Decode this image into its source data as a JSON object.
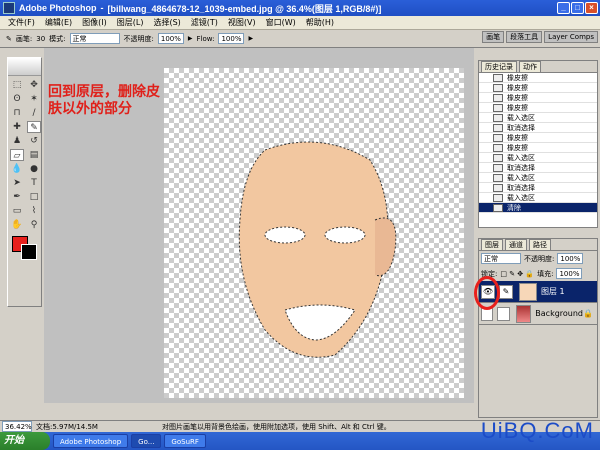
{
  "titlebar": {
    "app": "Adobe Photoshop",
    "file": "[billwang_4864678-12_1039-embed.jpg @ 36.4%(图层 1,RGB/8#)]"
  },
  "menu": [
    "文件(F)",
    "编辑(E)",
    "图像(I)",
    "图层(L)",
    "选择(S)",
    "滤镜(T)",
    "视图(V)",
    "窗口(W)",
    "帮助(H)"
  ],
  "options": {
    "brush_label": "画笔:",
    "brush_size": "30",
    "mode_label": "模式:",
    "mode_value": "正常",
    "opacity_label": "不透明度:",
    "opacity_value": "100%",
    "flow_label": "Flow:",
    "flow_value": "100%"
  },
  "panel_tabs": [
    "画笔",
    "段落工具",
    "Layer Comps"
  ],
  "annotation": "回到原层，删除皮肤以外的部分",
  "history": {
    "tabs": [
      "历史记录",
      "动作"
    ],
    "items": [
      "橡皮擦",
      "橡皮擦",
      "橡皮擦",
      "橡皮擦",
      "载入选区",
      "取消选择",
      "橡皮擦",
      "橡皮擦",
      "载入选区",
      "取消选择",
      "载入选区",
      "取消选择",
      "载入选区",
      "清除"
    ]
  },
  "layers": {
    "tabs": [
      "图层",
      "通道",
      "路径"
    ],
    "mode": "正常",
    "opacity_label": "不透明度:",
    "opacity_value": "100%",
    "lock_label": "锁定:",
    "fill_label": "填充:",
    "fill_value": "100%",
    "items": [
      {
        "name": "图层 1"
      },
      {
        "name": "Background"
      }
    ]
  },
  "status": {
    "zoom": "36.42%",
    "doc": "文档:5.97M/14.5M",
    "hint": "对图片画笔以用背景色绘画，使用附加选项，使用 Shift、Alt 和 Ctrl 键。"
  },
  "taskbar": {
    "start": "开始",
    "tasks": [
      "Adobe Photoshop",
      "Go...",
      "GoSuRF"
    ]
  },
  "watermark": "UiBQ.CoM"
}
